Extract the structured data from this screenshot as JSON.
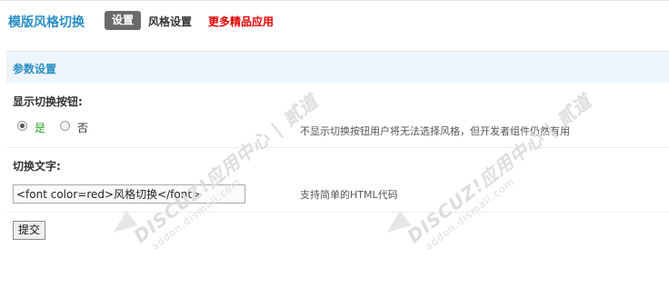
{
  "header": {
    "app_title": "模版风格切换",
    "tabs": [
      {
        "label": "设置",
        "active": true
      },
      {
        "label": "风格设置",
        "active": false
      },
      {
        "label": "更多精品应用",
        "active": false,
        "color": "#e00000"
      }
    ]
  },
  "section": {
    "title": "参数设置"
  },
  "fields": {
    "show_toggle": {
      "label": "显示切换按钮:",
      "options": [
        {
          "label": "是",
          "checked": true,
          "color": "#2aa02a"
        },
        {
          "label": "否",
          "checked": false
        }
      ],
      "hint": "不显示切换按钮用户将无法选择风格，但开发者组件仍然有用"
    },
    "toggle_text": {
      "label": "切换文字:",
      "value": "<font color=red>风格切换</font>",
      "hint": "支持简单的HTML代码"
    }
  },
  "submit_label": "提交",
  "watermark": {
    "line1": "DISCUZ!应用中心 | 贰道",
    "line2": "addon.dismall.com"
  },
  "colors": {
    "accent": "#2a8fc4",
    "section_bg": "#eef6fc",
    "tab_active_bg": "#6b6b6b",
    "promo": "#e00000"
  }
}
